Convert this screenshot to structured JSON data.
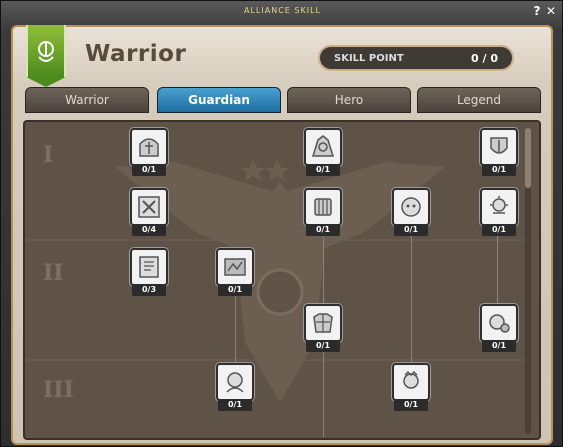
{
  "window": {
    "title": "ALLIANCE SKILL",
    "help": "?",
    "close": "✕"
  },
  "header": {
    "class_name": "Warrior",
    "skill_point_label": "SKILL POINT",
    "skill_point_value": "0 / 0"
  },
  "tabs": [
    {
      "label": "Warrior",
      "active": false
    },
    {
      "label": "Guardian",
      "active": true
    },
    {
      "label": "Hero",
      "active": false
    },
    {
      "label": "Legend",
      "active": false
    }
  ],
  "rows": [
    "I",
    "II",
    "III"
  ],
  "skills": [
    {
      "count": "0/1",
      "icon": "helmet-crest-icon"
    },
    {
      "count": "0/1",
      "icon": "armor-crest-icon"
    },
    {
      "count": "0/1",
      "icon": "armor-shield-icon"
    },
    {
      "count": "0/4",
      "icon": "cross-mark-icon"
    },
    {
      "count": "0/1",
      "icon": "armored-fist-icon"
    },
    {
      "count": "0/1",
      "icon": "knight-face-icon"
    },
    {
      "count": "0/1",
      "icon": "sun-shield-icon"
    },
    {
      "count": "0/3",
      "icon": "rune-tablet-icon"
    },
    {
      "count": "0/1",
      "icon": "battle-scene-icon"
    },
    {
      "count": "0/1",
      "icon": "guard-armor-icon"
    },
    {
      "count": "0/1",
      "icon": "pet-orb-icon"
    },
    {
      "count": "0/1",
      "icon": "warrior-portrait-icon"
    },
    {
      "count": "0/1",
      "icon": "princess-portrait-icon"
    }
  ]
}
